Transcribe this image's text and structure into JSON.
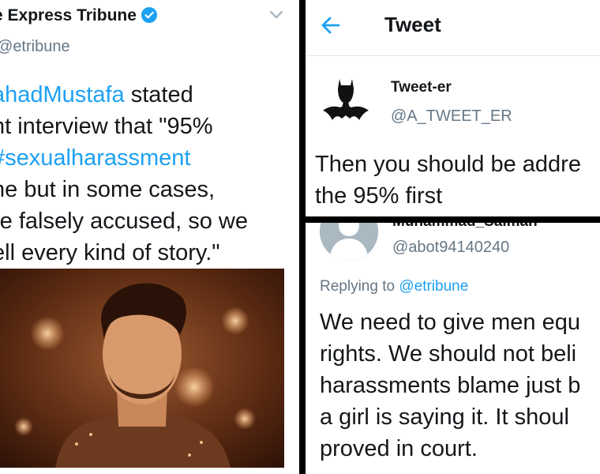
{
  "left_tweet": {
    "author_name": "e Express Tribune",
    "author_handle": "etribune",
    "body_lines": [
      {
        "parts": [
          {
            "text": "ahadMustafa",
            "link": true
          },
          {
            "text": " stated",
            "link": false
          }
        ]
      },
      {
        "parts": [
          {
            "text": "nt interview that \"95%",
            "link": false
          }
        ]
      },
      {
        "parts": [
          {
            "text": "#sexualharassment",
            "link": true
          }
        ]
      },
      {
        "parts": [
          {
            "text": "ne but in some cases,",
            "link": false
          }
        ]
      },
      {
        "parts": [
          {
            "text": "re falsely accused, so we",
            "link": false
          }
        ]
      },
      {
        "parts": [
          {
            "text": "ell every kind of story.\"",
            "link": false
          }
        ]
      }
    ]
  },
  "top_right": {
    "header_title": "Tweet",
    "author_name": "Tweet-er",
    "author_handle": "@A_TWEET_ER",
    "body_lines": [
      "Then you should be addre",
      "the 95% first"
    ]
  },
  "bottom_right": {
    "author_name": "Muhammad_Salman",
    "author_handle": "@abot94140240",
    "replying_prefix": "Replying to",
    "replying_handle": "@etribune",
    "body_lines": [
      "We need to give men equ",
      "rights. We should not beli",
      "harassments blame just b",
      "a girl is saying it. It shoul",
      "proved in court."
    ]
  },
  "colors": {
    "link": "#1da1f2",
    "text": "#14171a",
    "muted": "#657786",
    "photo_tone": "#7a3a1c"
  },
  "icons": {
    "verified": "verified-badge-icon",
    "chevron": "chevron-down-icon",
    "back": "back-arrow-icon",
    "batman_avatar": "batman-avatar-icon",
    "default_avatar": "default-profile-icon"
  }
}
